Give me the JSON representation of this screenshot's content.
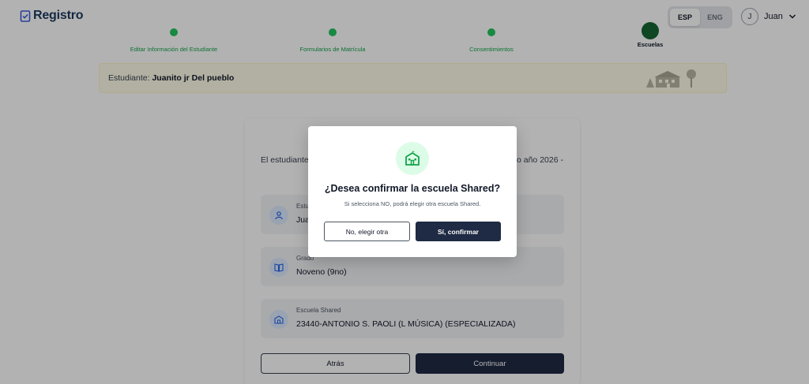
{
  "app": {
    "title": "Registro"
  },
  "header": {
    "languages": [
      {
        "label": "ESP",
        "active": true
      },
      {
        "label": "ENG",
        "active": false
      }
    ],
    "user": {
      "initial": "J",
      "name": "Juan"
    }
  },
  "stepper": {
    "steps": [
      {
        "label": "Editar Información del Estudiante",
        "state": "complete"
      },
      {
        "label": "Formularios de Matrícula",
        "state": "complete"
      },
      {
        "label": "Consentimientos",
        "state": "complete"
      },
      {
        "label": "Escuelas",
        "state": "current"
      }
    ]
  },
  "banner": {
    "prefix": "Estudiante:",
    "student_name": "Juanito jr Del pueblo"
  },
  "card": {
    "intro_left": "El estudiante",
    "intro_right": "o año 2026 -",
    "rows": [
      {
        "label": "Estu",
        "value": "Jua",
        "icon": "user-icon"
      },
      {
        "label": "Grado",
        "value": "Noveno (9no)",
        "icon": "book-icon"
      },
      {
        "label": "Escuela Shared",
        "value": "23440-ANTONIO S. PAOLI (L MÚSICA) (ESPECIALIZADA)",
        "icon": "school-icon"
      }
    ],
    "back_label": "Atrás",
    "continue_label": "Continuar"
  },
  "modal": {
    "icon": "school-icon",
    "title": "¿Desea confirmar la escuela Shared?",
    "subtitle": "Si selecciona NO, podrá elegir otra escuela Shared.",
    "no_label": "No, elegir otra",
    "yes_label": "Sí, confirmar"
  },
  "colors": {
    "primary": "#1f2a44",
    "accent_green": "#22c55e",
    "banner_bg": "#fefce8"
  }
}
